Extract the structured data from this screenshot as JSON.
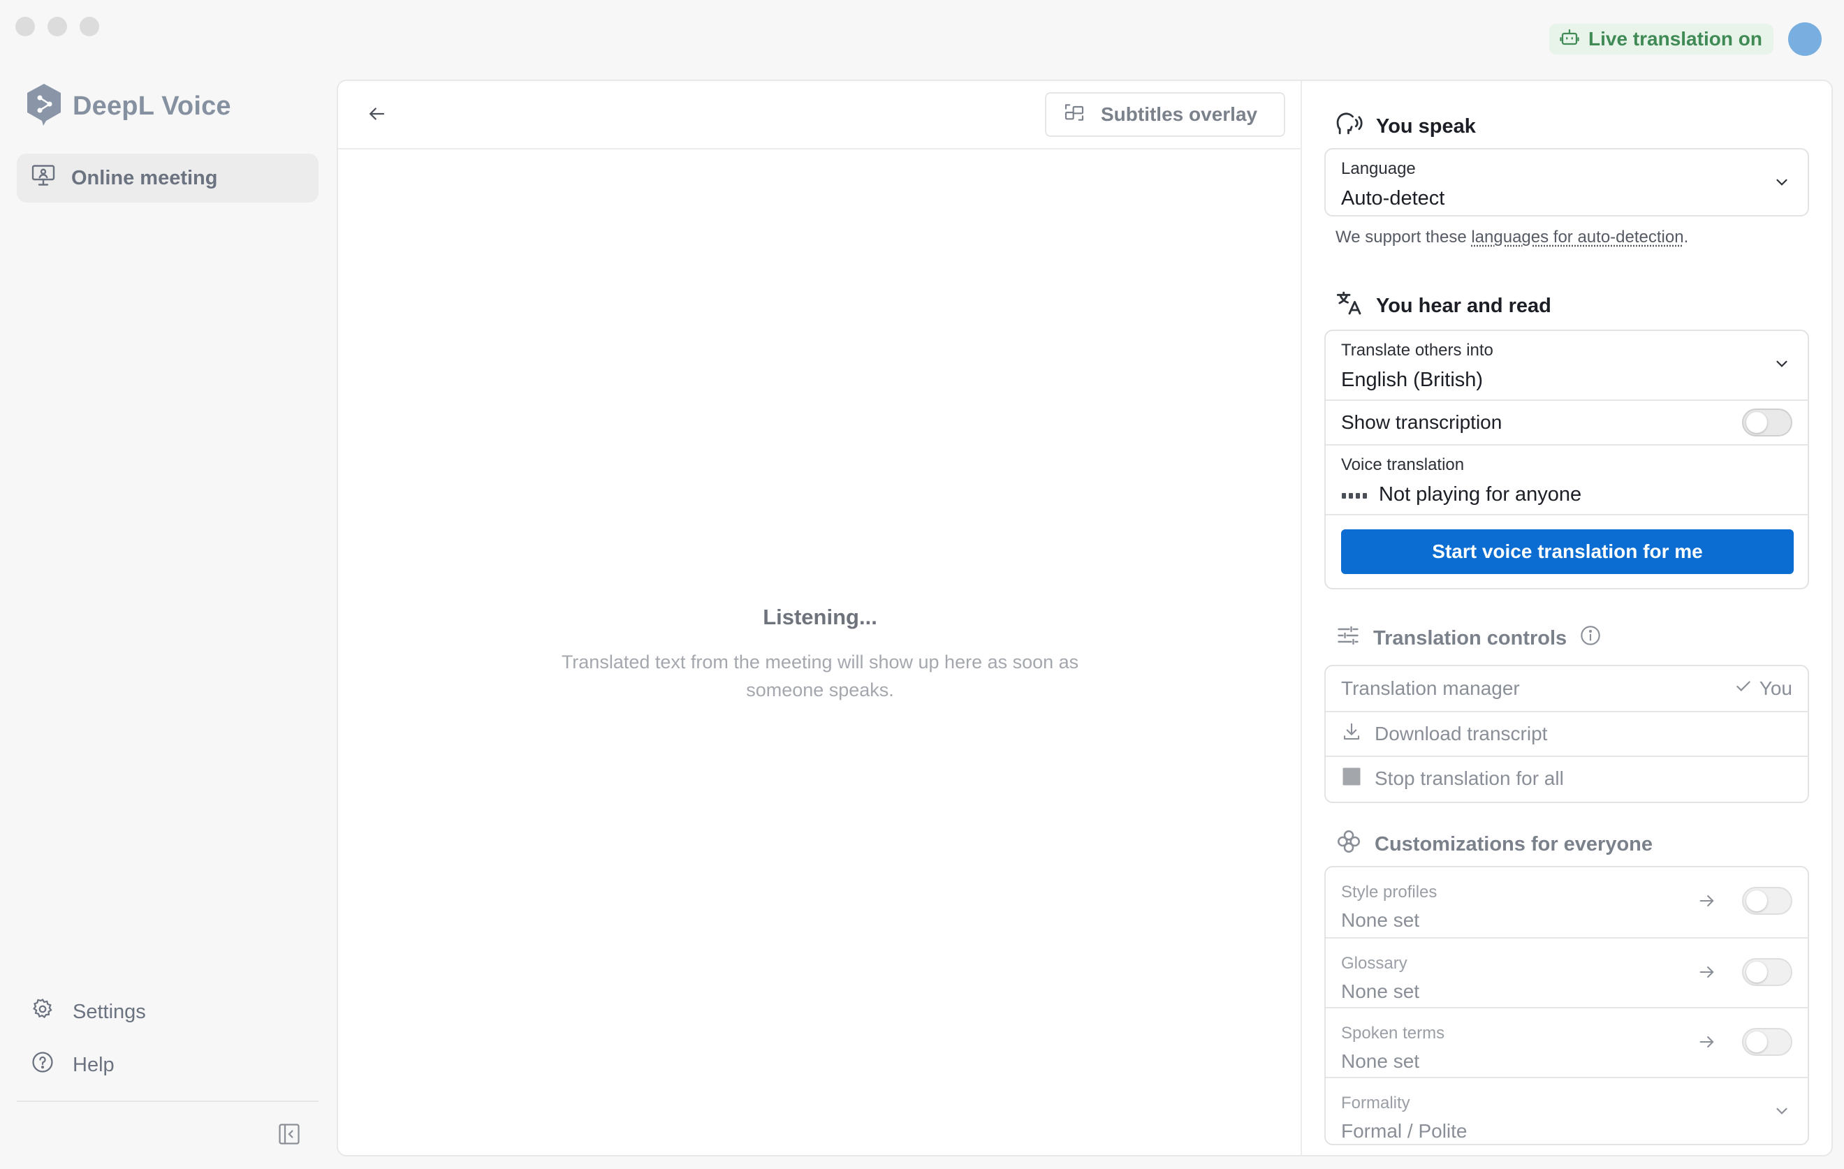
{
  "window": {
    "live_status": "Live translation on"
  },
  "sidebar": {
    "brand": "DeepL Voice",
    "items": [
      {
        "label": "Online meeting"
      }
    ],
    "bottom": [
      {
        "label": "Settings"
      },
      {
        "label": "Help"
      }
    ]
  },
  "main": {
    "subtitles_button": "Subtitles overlay",
    "listening_title": "Listening...",
    "listening_desc": "Translated text from the meeting will show up here as soon as someone speaks."
  },
  "you_speak": {
    "title": "You speak",
    "language_label": "Language",
    "language_value": "Auto-detect",
    "hint_prefix": "We support these ",
    "hint_link": "languages for auto-detection",
    "hint_suffix": "."
  },
  "you_hear": {
    "title": "You hear and read",
    "translate_label": "Translate others into",
    "translate_value": "English (British)",
    "show_transcription": "Show transcription",
    "voice_label": "Voice translation",
    "voice_value": "Not playing for anyone",
    "start_button": "Start voice translation for me"
  },
  "controls": {
    "title": "Translation controls",
    "manager_label": "Translation manager",
    "manager_value": "You",
    "download": "Download transcript",
    "stop": "Stop translation for all"
  },
  "customizations": {
    "title": "Customizations for everyone",
    "items": [
      {
        "label": "Style profiles",
        "value": "None set"
      },
      {
        "label": "Glossary",
        "value": "None set"
      },
      {
        "label": "Spoken terms",
        "value": "None set"
      }
    ],
    "formality_label": "Formality",
    "formality_value": "Formal / Polite"
  },
  "colors": {
    "accent": "#0b6dd1",
    "live_green": "#3f8a55",
    "live_bg": "#e8f3ea"
  }
}
